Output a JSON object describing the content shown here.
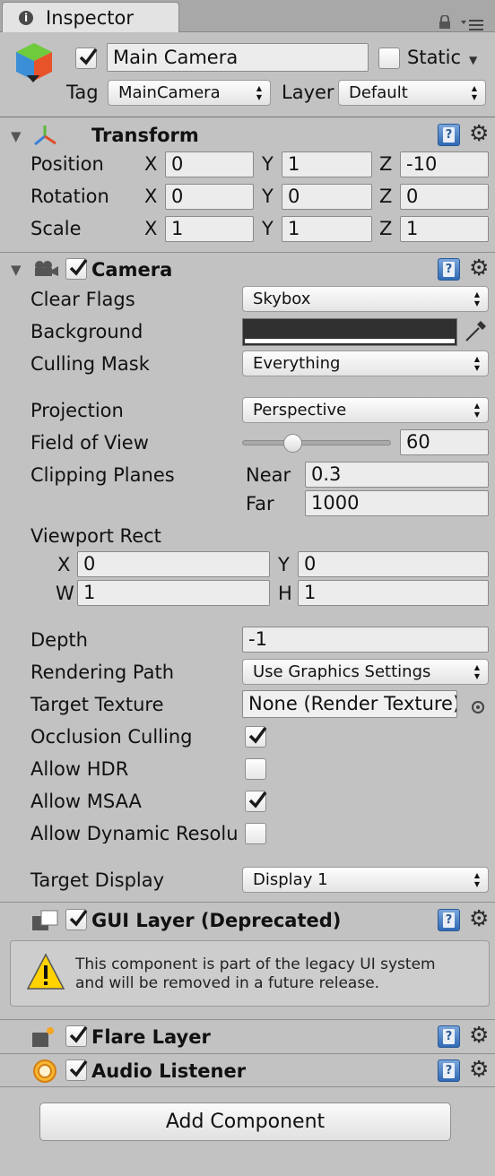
{
  "tab": {
    "title": "Inspector"
  },
  "object": {
    "name": "Main Camera",
    "static_label": "Static",
    "tag_label": "Tag",
    "tag_value": "MainCamera",
    "layer_label": "Layer",
    "layer_value": "Default",
    "active": true,
    "static": false
  },
  "transform": {
    "title": "Transform",
    "rows": [
      {
        "label": "Position",
        "x": "0",
        "y": "1",
        "z": "-10"
      },
      {
        "label": "Rotation",
        "x": "0",
        "y": "0",
        "z": "0"
      },
      {
        "label": "Scale",
        "x": "1",
        "y": "1",
        "z": "1"
      }
    ],
    "axis": {
      "x": "X",
      "y": "Y",
      "z": "Z"
    }
  },
  "camera": {
    "title": "Camera",
    "enabled": true,
    "clear_flags": {
      "label": "Clear Flags",
      "value": "Skybox"
    },
    "background": {
      "label": "Background",
      "color": "#303030"
    },
    "culling_mask": {
      "label": "Culling Mask",
      "value": "Everything"
    },
    "projection": {
      "label": "Projection",
      "value": "Perspective"
    },
    "fov": {
      "label": "Field of View",
      "value": "60",
      "slider_fraction": 0.32
    },
    "clipping": {
      "label": "Clipping Planes",
      "near_label": "Near",
      "near": "0.3",
      "far_label": "Far",
      "far": "1000"
    },
    "viewport": {
      "label": "Viewport Rect",
      "x_label": "X",
      "x": "0",
      "y_label": "Y",
      "y": "0",
      "w_label": "W",
      "w": "1",
      "h_label": "H",
      "h": "1"
    },
    "depth": {
      "label": "Depth",
      "value": "-1"
    },
    "rendering_path": {
      "label": "Rendering Path",
      "value": "Use Graphics Settings"
    },
    "target_texture": {
      "label": "Target Texture",
      "value": "None (Render Texture)"
    },
    "occlusion": {
      "label": "Occlusion Culling",
      "checked": true
    },
    "hdr": {
      "label": "Allow HDR",
      "checked": false
    },
    "msaa": {
      "label": "Allow MSAA",
      "checked": true
    },
    "dynamic": {
      "label": "Allow Dynamic Resolu",
      "checked": false
    },
    "target_display": {
      "label": "Target Display",
      "value": "Display 1"
    }
  },
  "gui_layer": {
    "title": "GUI Layer (Deprecated)",
    "enabled": true,
    "warning_line1": "This component is part of the legacy UI system",
    "warning_line2": "and will be removed in a future release."
  },
  "flare_layer": {
    "title": "Flare Layer",
    "enabled": true
  },
  "audio_listener": {
    "title": "Audio Listener",
    "enabled": true
  },
  "add_component": {
    "label": "Add Component"
  },
  "icons": {
    "help": "?",
    "gear": "⚙",
    "lock": "lock-icon",
    "menu": "menu-icon"
  },
  "colors": {
    "panel": "#c2c2c2",
    "tab": "#e4e4e4",
    "accent": "#1a1a1a"
  }
}
